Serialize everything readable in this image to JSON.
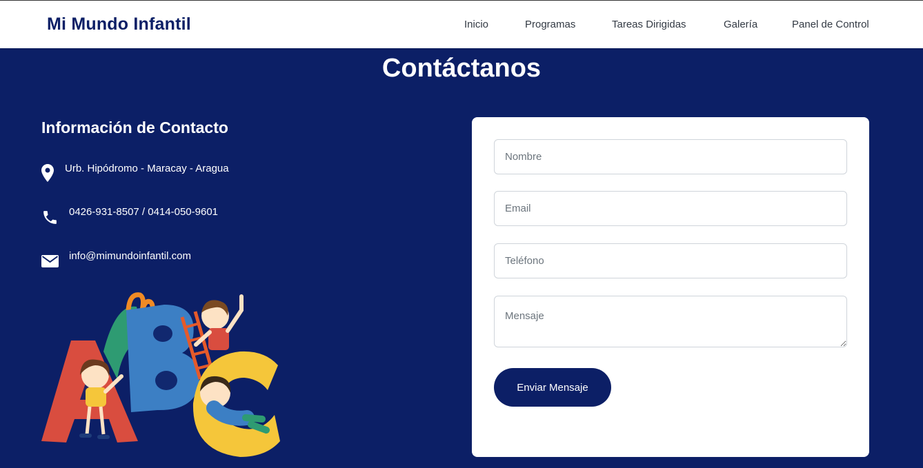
{
  "brand": "Mi Mundo Infantil",
  "nav": [
    "Inicio",
    "Programas",
    "Tareas Dirigidas",
    "Galería",
    "Panel de Control"
  ],
  "section_title": "Contáctanos",
  "contact": {
    "title": "Información de Contacto",
    "items": [
      {
        "icon": "location-pin-icon",
        "text": "Urb. Hipódromo - Maracay - Aragua"
      },
      {
        "icon": "phone-icon",
        "text": "0426-931-8507 / 0414-050-9601"
      },
      {
        "icon": "envelope-icon",
        "text": "info@mimundoinfantil.com"
      }
    ]
  },
  "form": {
    "name_placeholder": "Nombre",
    "email_placeholder": "Email",
    "phone_placeholder": "Teléfono",
    "message_placeholder": "Mensaje",
    "submit_label": "Enviar Mensaje"
  },
  "colors": {
    "primary": "#0c1f66",
    "background": "#0c1f66",
    "card": "#ffffff",
    "navbar": "#ffffff"
  }
}
